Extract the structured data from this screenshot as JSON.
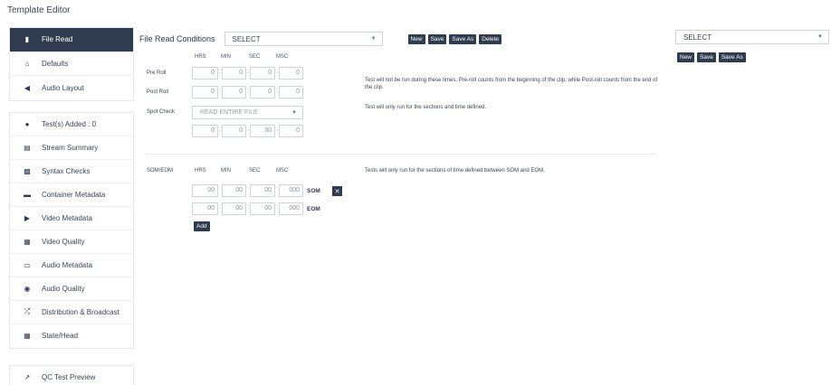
{
  "page_title": "Template Editor",
  "sidebar": {
    "group_a": [
      {
        "label": "File Read",
        "icon": "file-icon",
        "active": true
      },
      {
        "label": "Defaults",
        "icon": "home-icon",
        "active": false
      },
      {
        "label": "Audio Layout",
        "icon": "speaker-icon",
        "active": false
      }
    ],
    "group_b": [
      {
        "label": "Test(s) Added : 0",
        "icon": "circle-icon"
      },
      {
        "label": "Stream Summary",
        "icon": "summary-icon"
      },
      {
        "label": "Syntax Checks",
        "icon": "syntax-icon"
      },
      {
        "label": "Container Metadata",
        "icon": "container-icon"
      },
      {
        "label": "Video Metadata",
        "icon": "video-icon"
      },
      {
        "label": "Video Quality",
        "icon": "film-icon"
      },
      {
        "label": "Audio Metadata",
        "icon": "audio-file-icon"
      },
      {
        "label": "Audio Quality",
        "icon": "volume-icon"
      },
      {
        "label": "Distribution & Broadcast",
        "icon": "shuffle-icon"
      },
      {
        "label": "State/Head",
        "icon": "grid-icon"
      }
    ],
    "group_c": [
      {
        "label": "QC Test Preview",
        "icon": "external-link-icon"
      }
    ]
  },
  "file_read": {
    "label": "File Read Conditions",
    "select_value": "SELECT",
    "buttons": {
      "new": "New",
      "save": "Save",
      "save_as": "Save As",
      "delete": "Delete"
    }
  },
  "right_panel": {
    "select_value": "SELECT",
    "buttons": {
      "new": "New",
      "save": "Save",
      "save_as": "Save As"
    }
  },
  "time_headers": {
    "hrs": "HRS",
    "min": "MIN",
    "sec": "SEC",
    "msc": "MSC"
  },
  "pre_roll": {
    "label": "Pre Roll",
    "values": [
      "0",
      "0",
      "0",
      "0"
    ]
  },
  "post_roll": {
    "label": "Post Roll",
    "values": [
      "0",
      "0",
      "0",
      "0"
    ]
  },
  "spot_check": {
    "label": "Spot Check",
    "select_value": "READ ENTIRE FILE",
    "values": [
      "0",
      "0",
      "30",
      "0"
    ]
  },
  "notes": {
    "roll": "Test will not be run during these times. Pre-roll counts from the beginning of the clip, while Post-roll counts from the end of the clip.",
    "spot": "Test will only run for the sections and time defined.",
    "som_eom": "Tests will only run for the sections of time defined between SOM and EOM."
  },
  "som_eom": {
    "label": "SOM/EOM",
    "som_values": [
      "00",
      "00",
      "00",
      "000"
    ],
    "eom_values": [
      "00",
      "00",
      "00",
      "000"
    ],
    "som_label": "SOM",
    "eom_label": "EOM",
    "remove": "✕",
    "add": "Add"
  }
}
